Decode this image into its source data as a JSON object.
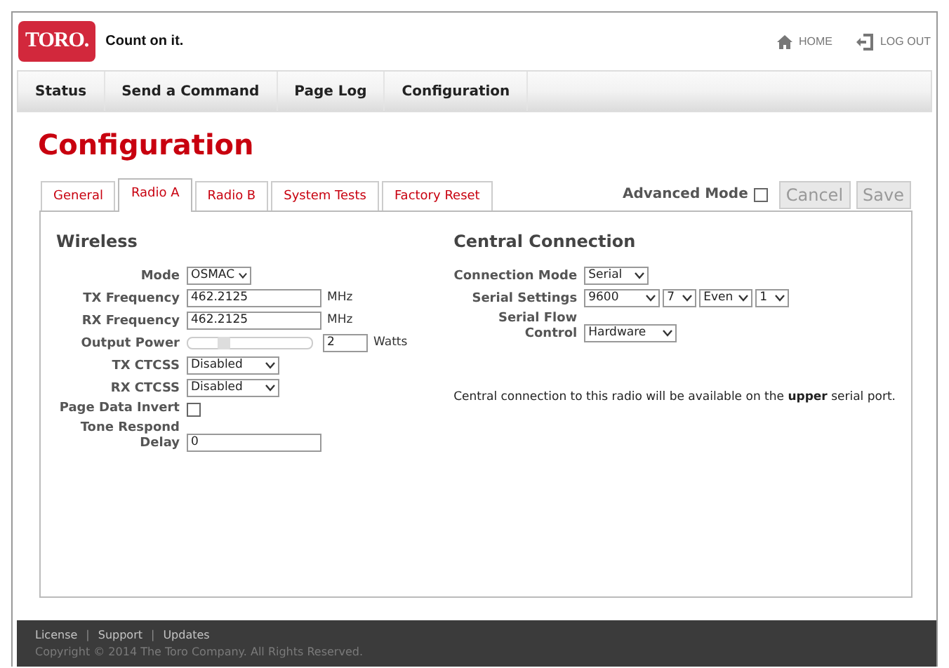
{
  "header": {
    "logo": "TORO.",
    "tagline": "Count on it.",
    "links": [
      {
        "kind": "home",
        "label": "HOME"
      },
      {
        "kind": "logout",
        "label": "LOG OUT"
      }
    ]
  },
  "nav": [
    {
      "label": "Status"
    },
    {
      "label": "Send a Command"
    },
    {
      "label": "Page Log"
    },
    {
      "label": "Configuration"
    }
  ],
  "page_title": "Configuration",
  "tabs": [
    {
      "label": "General",
      "selected": false
    },
    {
      "label": "Radio A",
      "selected": true
    },
    {
      "label": "Radio B",
      "selected": false
    },
    {
      "label": "System Tests",
      "selected": false
    },
    {
      "label": "Factory Reset",
      "selected": false
    }
  ],
  "advanced_mode": {
    "label": "Advanced Mode",
    "checked": false
  },
  "buttons": [
    {
      "label": "Cancel",
      "disabled": true
    },
    {
      "label": "Save",
      "disabled": true
    }
  ],
  "wireless": {
    "title": "Wireless",
    "fields": [
      {
        "kind": "select",
        "label": "Mode",
        "value": "OSMAC"
      },
      {
        "kind": "text",
        "label": "TX Frequency",
        "value": "462.2125",
        "unit": "MHz"
      },
      {
        "kind": "text",
        "label": "RX Frequency",
        "value": "462.2125",
        "unit": "MHz"
      },
      {
        "kind": "slider",
        "label": "Output Power",
        "level": 0.3,
        "value": "2",
        "unit": "Watts"
      },
      {
        "kind": "select",
        "label": "TX CTCSS",
        "value": "Disabled"
      },
      {
        "kind": "select",
        "label": "RX CTCSS",
        "value": "Disabled"
      },
      {
        "kind": "checkbox",
        "label": "Page Data Invert",
        "checked": false
      },
      {
        "kind": "text",
        "label": "Tone Respond Delay",
        "value": "0"
      }
    ]
  },
  "central": {
    "title": "Central Connection",
    "fields": [
      {
        "kind": "select",
        "label": "Connection Mode",
        "value": "Serial"
      },
      {
        "kind": "selects",
        "label": "Serial Settings",
        "values": [
          "9600",
          "7",
          "Even",
          "1"
        ]
      },
      {
        "kind": "select",
        "label": "Serial Flow Control",
        "value": "Hardware"
      }
    ],
    "note": "Central connection to this radio will be available on the **upper** serial port."
  },
  "footer": {
    "links": [
      {
        "kind": "link",
        "text": "License"
      },
      {
        "kind": "separator",
        "text": "|"
      },
      {
        "kind": "link",
        "text": "Support"
      },
      {
        "kind": "separator",
        "text": "|"
      },
      {
        "kind": "link",
        "text": "Updates"
      }
    ],
    "copyright": "Copyright © 2014 The Toro Company. All Rights Reserved."
  }
}
